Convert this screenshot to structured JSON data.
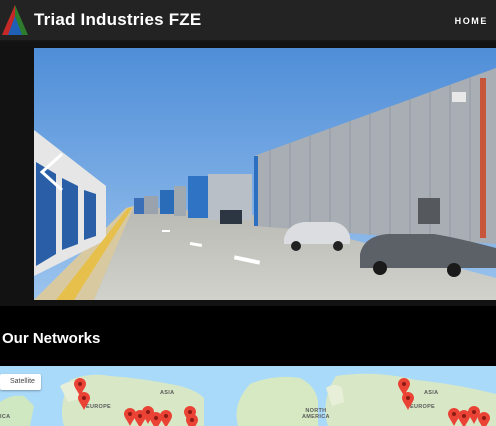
{
  "header": {
    "site_title": "Triad Industries FZE",
    "nav_home": "HOME"
  },
  "hero": {
    "image_description_icon": "industrial-warehouse-photo",
    "prev_icon": "chevron-left-icon"
  },
  "networks": {
    "title": "Our Networks",
    "map": {
      "map_type_label": "Satellite",
      "labels": {
        "asia_1": "ASIA",
        "europe_1": "EUROPE",
        "north_america": "NORTH\nAMERICA",
        "asia_2": "ASIA",
        "europe_2": "EUROPE",
        "africa_left": "ICA"
      }
    }
  },
  "colors": {
    "header_bg": "#232323",
    "section_bg": "#000000",
    "pin_red": "#ea4335",
    "sky": "#6aa0df"
  }
}
